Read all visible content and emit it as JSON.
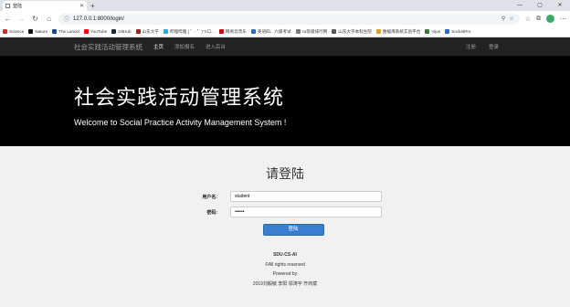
{
  "browser": {
    "tab_title": "登陆",
    "url": "127.0.0.1:8000/login/",
    "bookmarks": [
      {
        "label": "Science",
        "color": "#d32f2f"
      },
      {
        "label": "Nature",
        "color": "#111111"
      },
      {
        "label": "The Lancet",
        "color": "#1a4b8c"
      },
      {
        "label": "YouTube",
        "color": "#ff0000"
      },
      {
        "label": "GitHub",
        "color": "#24292e"
      },
      {
        "label": "山东大学",
        "color": "#a31f1f"
      },
      {
        "label": "哔哩哔哩 ( ゜- ゜)つロ...",
        "color": "#23ade5"
      },
      {
        "label": "网易云音乐",
        "color": "#c20c0c"
      },
      {
        "label": "英语四、六级考试",
        "color": "#2a6ebb"
      },
      {
        "label": "cs等级排行网",
        "color": "#777777"
      },
      {
        "label": "山东大学本科生院",
        "color": "#555555"
      },
      {
        "label": "数据库系统实验平台",
        "color": "#e0a020"
      },
      {
        "label": "Vijos",
        "color": "#3a7a3a"
      },
      {
        "label": "SocketPro",
        "color": "#2b66c9"
      }
    ]
  },
  "navbar": {
    "brand": "社会实践活动管理系统",
    "links": [
      "主页",
      "添加报名",
      "进入后台"
    ],
    "right": [
      "注册",
      "登录"
    ]
  },
  "hero": {
    "title": "社会实践活动管理系统",
    "subtitle": "Welcome to Social Practice Activity Management System !"
  },
  "login": {
    "heading": "请登陆",
    "username_label": "用户名:",
    "username_value": "student",
    "password_label": "密码:",
    "password_value": "••••••",
    "submit": "登陆"
  },
  "footer": {
    "team": "SDU-CS-AI",
    "rights": "©All rights reserved",
    "powered": "Powered by",
    "authors": "2019刘毅敏 李阳 邬涛宇 齐商斌"
  }
}
